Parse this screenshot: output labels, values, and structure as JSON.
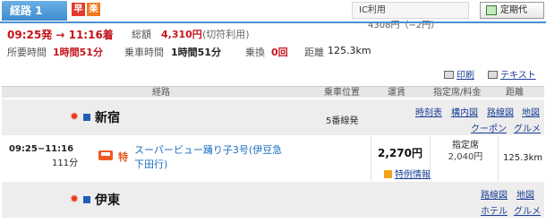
{
  "route_tab": "経路 1",
  "badges": {
    "early": "早",
    "cheap": "楽"
  },
  "ic": {
    "label": "IC利用",
    "fare": "4308円（−2円）"
  },
  "teiki_button": "定期代",
  "summary": {
    "time_range": "09:25発 → 11:16着",
    "total_label": "総額",
    "total_value": "4,310円",
    "kippu_note": "(切符利用)",
    "duration_label": "所要時間",
    "duration_value": "1時間51分",
    "ride_label": "乗車時間",
    "ride_value": "1時間51分",
    "transfer_label": "乗換",
    "transfer_value": "0回",
    "distance_label": "距離",
    "distance_value": "125.3km"
  },
  "print_links": {
    "print": "印刷",
    "text": "テキスト"
  },
  "table_header": {
    "route": "経路",
    "position": "乗車位置",
    "fare": "運賃",
    "reserved": "指定席/料金",
    "distance": "距離"
  },
  "departure": {
    "name": "新宿",
    "platform": "5番線発",
    "links": [
      "時刻表",
      "構内図",
      "路線図",
      "地図",
      "クーポン",
      "グルメ"
    ]
  },
  "segment": {
    "time": "09:25−11:16",
    "minutes": "111分",
    "type_mark": "特",
    "train_name": "スーパービュー踊り子3号(伊豆急下田行)",
    "fare": "2,270円",
    "seat_label": "指定席",
    "seat_fare": "2,040円",
    "distance": "125.3km",
    "special_link": "特例情報"
  },
  "arrival": {
    "name": "伊東",
    "links": [
      "路線図",
      "地図",
      "ホテル",
      "グルメ"
    ]
  },
  "colors": {
    "accent": "#4b91d1",
    "red": "#c4151c",
    "link": "#1b3e96"
  }
}
